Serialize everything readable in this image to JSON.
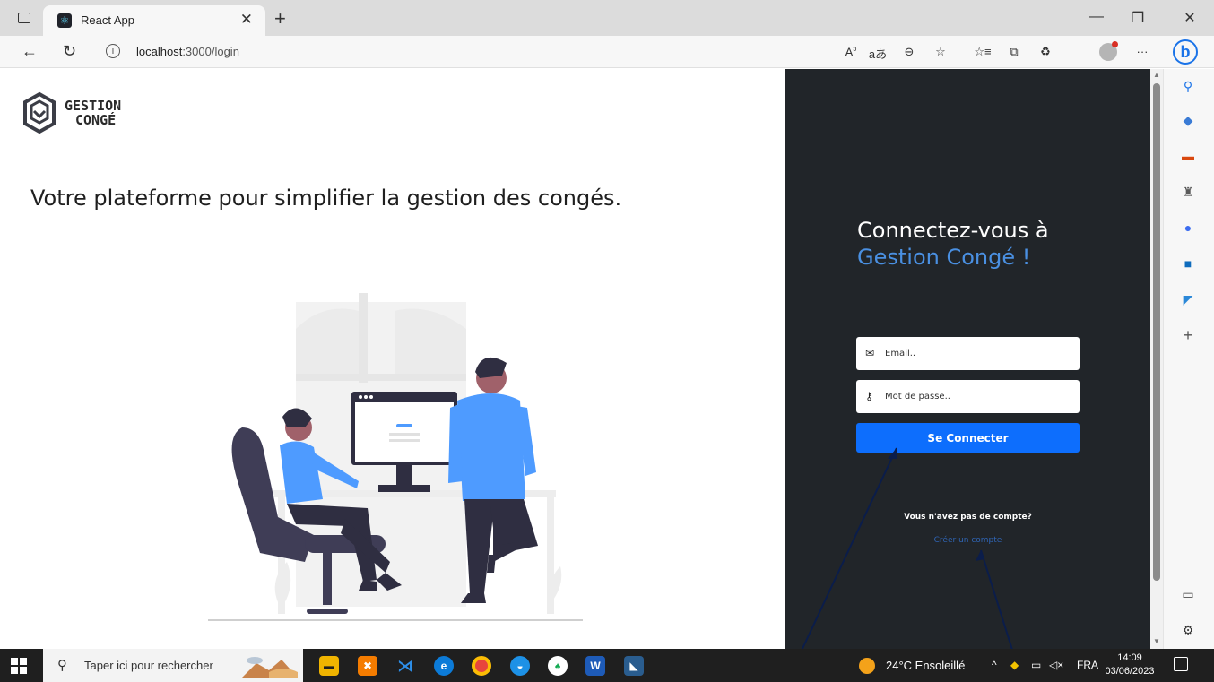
{
  "browser": {
    "tab_title": "React App",
    "tab_close": "✕",
    "new_tab": "+",
    "url_host": "localhost",
    "url_rest": ":3000/login",
    "window": {
      "minimize": "—",
      "restore": "❐",
      "close": "✕"
    },
    "more": "···"
  },
  "page": {
    "logo": {
      "line1": "GESTION",
      "line2": "CONGÉ"
    },
    "tagline": "Votre plateforme pour simplifier la gestion des congés.",
    "login": {
      "heading_line1": "Connectez-vous à",
      "heading_line2": "Gestion Congé !",
      "email_placeholder": "Email..",
      "password_placeholder": "Mot de passe..",
      "submit_label": "Se Connecter",
      "no_account_text": "Vous n'avez pas de compte?",
      "create_account_link": "Créer un compte"
    }
  },
  "taskbar": {
    "search_placeholder": "Taper ici pour rechercher",
    "weather": "24°C  Ensoleillé",
    "language": "FRA",
    "time": "14:09",
    "date": "03/06/2023"
  },
  "colors": {
    "dark_panel": "#212529",
    "accent_blue": "#4a90e2",
    "button_blue": "#0d6efd",
    "link_blue": "#2f64b3",
    "illustration_blue": "#4e9bff"
  }
}
